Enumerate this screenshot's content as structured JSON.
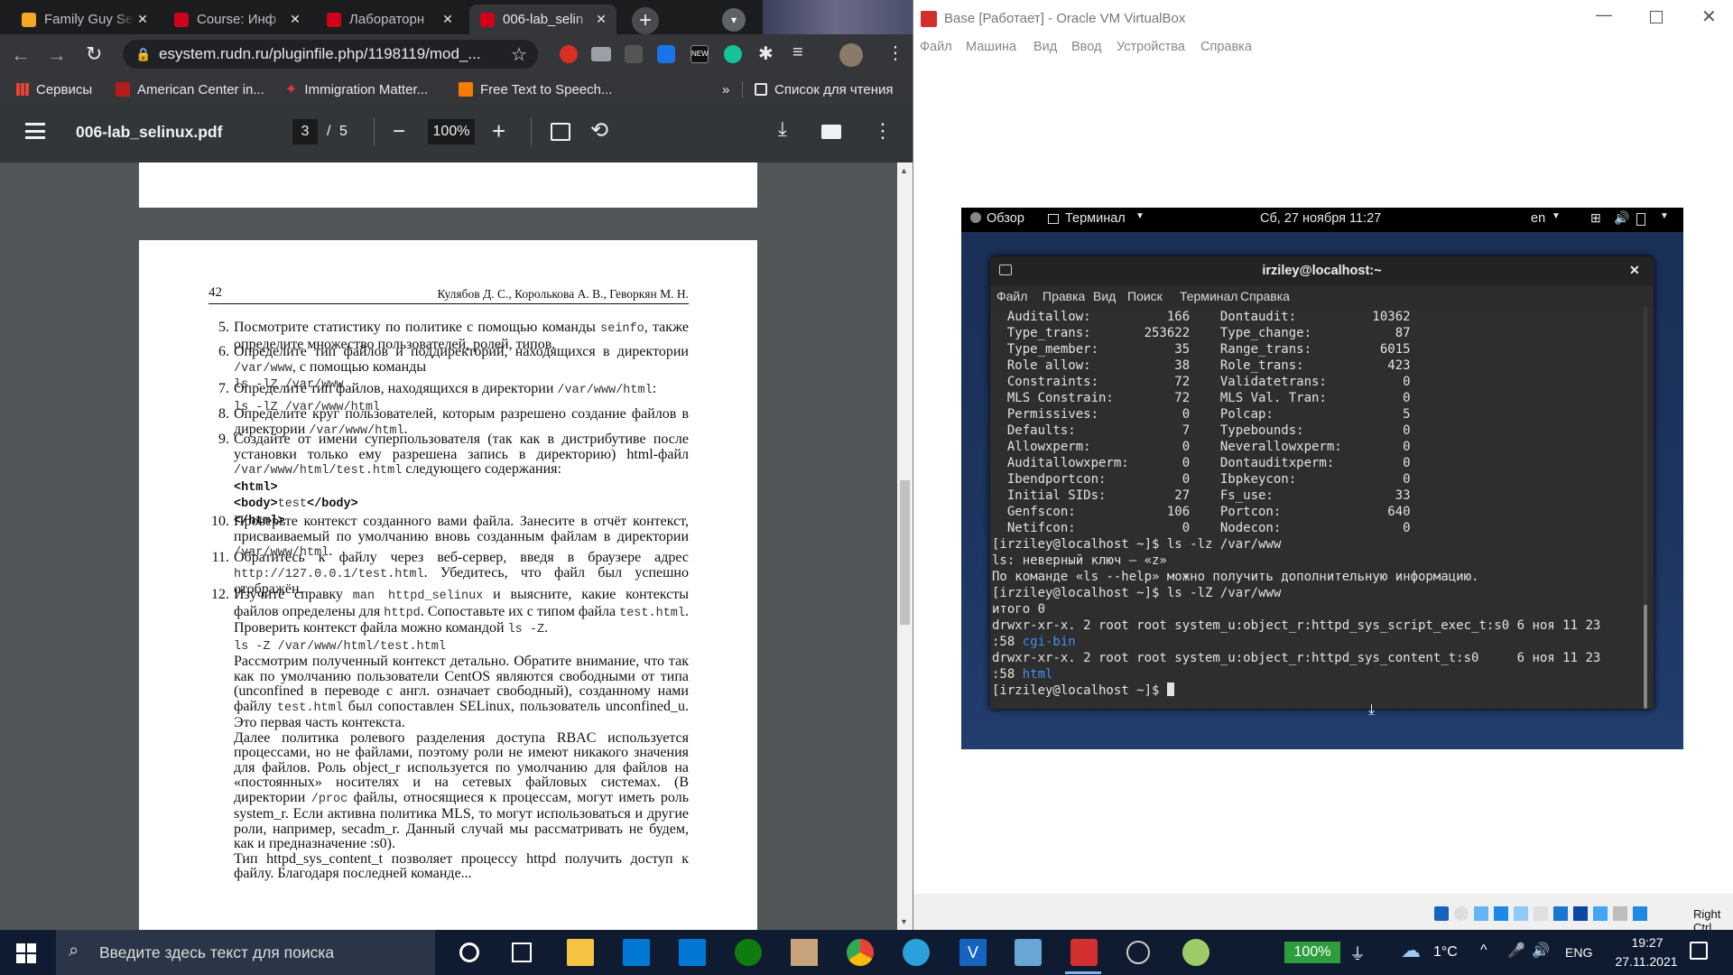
{
  "browser": {
    "tabs": [
      {
        "label": "Family Guy Se"
      },
      {
        "label": "Course: Инф"
      },
      {
        "label": "Лабораторн"
      },
      {
        "label": "006-lab_selin"
      }
    ],
    "url": "esystem.rudn.ru/pluginfile.php/1198119/mod_...",
    "bookmarks": [
      "Сервисы",
      "American Center in...",
      "Immigration Matter...",
      "Free Text to Speech..."
    ],
    "reading_list": "Список для чтения",
    "more_bookmarks": "»"
  },
  "pdf": {
    "filename": "006-lab_selinux.pdf",
    "page_current": "3",
    "page_sep": "/",
    "page_total": "5",
    "zoom": "100%",
    "header_page": "42",
    "header_authors": "Кулябов Д. С., Королькова А. В., Геворкян М. Н.",
    "items": [
      {
        "num": "5.",
        "html": "Посмотрите статистику по политике с помощью команды <span class=\"mono\">seinfo</span>, также определите множество пользователей, ролей, типов."
      },
      {
        "num": "6.",
        "html": "Определите тип файлов и поддиректорий, находящихся в директории <span class=\"mono\">/var/www</span>, с помощью команды<br><span class=\"mono\">ls -lZ /var/www</span>"
      },
      {
        "num": "7.",
        "html": "Определите тип файлов, находящихся в директории <span class=\"mono\">/var/www/html</span>:<br><span class=\"mono\">ls -lZ /var/www/html</span>"
      },
      {
        "num": "8.",
        "html": "Определите круг пользователей, которым разрешено создание файлов в директории <span class=\"mono\">/var/www/html</span>."
      },
      {
        "num": "9.",
        "html": "Создайте от имени суперпользователя (так как в дистрибутиве после установки только ему разрешена запись в директорию) html-файл <span class=\"mono\">/var/www/html/test.html</span> следующего содержания:<br><b style=\"font-family:'Liberation Mono',monospace;font-size:13.5px\">&lt;html&gt;</b><br><b style=\"font-family:'Liberation Mono',monospace;font-size:13.5px\">&lt;body&gt;</b><span class=\"mono\">test</span><b style=\"font-family:'Liberation Mono',monospace;font-size:13.5px\">&lt;/body&gt;</b><br><b style=\"font-family:'Liberation Mono',monospace;font-size:13.5px\">&lt;/html&gt;</b>"
      },
      {
        "num": "10.",
        "html": "Проверьте контекст созданного вами файла. Занесите в отчёт контекст, присваиваемый по умолчанию вновь созданным файлам в директории <span class=\"mono\">/var/www/html</span>."
      },
      {
        "num": "11.",
        "html": "Обратитесь к файлу через веб-сервер, введя в браузере адрес <span class=\"mono\">http://127.0.0.1/test.html</span>. Убедитесь, что файл был успешно отображён."
      },
      {
        "num": "12.",
        "html": "Изучите справку <span class=\"mono\">man httpd_selinux</span> и выясните, какие контексты файлов определены для <span class=\"mono\">httpd</span>. Сопоставьте их с типом файла <span class=\"mono\">test.html</span>. Проверить контекст файла можно командой <span class=\"mono\">ls -Z</span>.<br><span class=\"mono\">ls -Z /var/www/html/test.html</span><br>Рассмотрим полученный контекст детально. Обратите внимание, что так как по умолчанию пользователи CentOS являются свободными от типа (unconfined в переводе с англ. означает свободный), созданному нами файлу <span class=\"mono\">test.html</span> был сопоставлен SELinux, пользователь unconfined_u. Это первая часть контекста.<br>Далее политика ролевого разделения доступа RBAC используется процессами, но не файлами, поэтому роли не имеют никакого значения для файлов. Роль object_r используется по умолчанию для файлов на «постоянных» носителях и на сетевых файловых системах. (В директории <span class=\"mono\">/proc</span> файлы, относящиеся к процессам, могут иметь роль system_r. Если активна политика MLS, то могут использоваться и другие роли, например, secadm_r. Данный случай мы рассматривать не будем, как и предназначение :s0).<br>Тип httpd_sys_content_t позволяет процессу httpd получить доступ к файлу. Благодаря последней команде..."
      }
    ]
  },
  "vbox": {
    "title": "Base [Работает] - Oracle VM VirtualBox",
    "menu": [
      "Файл",
      "Машина",
      "Вид",
      "Ввод",
      "Устройства",
      "Справка"
    ],
    "host_key": "Right Ctrl"
  },
  "gnome": {
    "activities": "Обзор",
    "app": "Терминал",
    "clock": "Сб, 27 ноября 11:27",
    "lang": "en"
  },
  "terminal": {
    "title": "irziley@localhost:~",
    "menu": [
      "Файл",
      "Правка",
      "Вид",
      "Поиск",
      "Терминал",
      "Справка"
    ],
    "lines": [
      "  Auditallow:          166    Dontaudit:          10362",
      "  Type_trans:       253622    Type_change:           87",
      "  Type_member:          35    Range_trans:         6015",
      "  Role allow:           38    Role_trans:           423",
      "  Constraints:          72    Validatetrans:          0",
      "  MLS Constrain:        72    MLS Val. Tran:          0",
      "  Permissives:           0    Polcap:                 5",
      "  Defaults:              7    Typebounds:             0",
      "  Allowxperm:            0    Neverallowxperm:        0",
      "  Auditallowxperm:       0    Dontauditxperm:         0",
      "  Ibendportcon:          0    Ibpkeycon:              0",
      "  Initial SIDs:         27    Fs_use:                33",
      "  Genfscon:            106    Portcon:              640",
      "  Netifcon:              0    Nodecon:                0",
      "[irziley@localhost ~]$ ls -lz /var/www",
      "ls: неверный ключ — «z»",
      "По команде «ls --help» можно получить дополнительную информацию.",
      "[irziley@localhost ~]$ ls -lZ /var/www",
      "итого 0",
      "drwxr-xr-x. 2 root root system_u:object_r:httpd_sys_script_exec_t:s0 6 ноя 11 23",
      ":58 ",
      "drwxr-xr-x. 2 root root system_u:object_r:httpd_sys_content_t:s0     6 ноя 11 23",
      ":58 ",
      "[irziley@localhost ~]$ "
    ],
    "dir1": "cgi-bin",
    "dir2": "html"
  },
  "taskbar": {
    "search_placeholder": "Введите здесь текст для поиска",
    "battery": "100%",
    "weather": "1°C",
    "lang": "ENG",
    "time": "19:27",
    "date": "27.11.2021"
  },
  "colors": {
    "accent": "#3f8ff5",
    "terminal_bg": "#2e2e2e",
    "taskbar": "#0e1b30"
  }
}
